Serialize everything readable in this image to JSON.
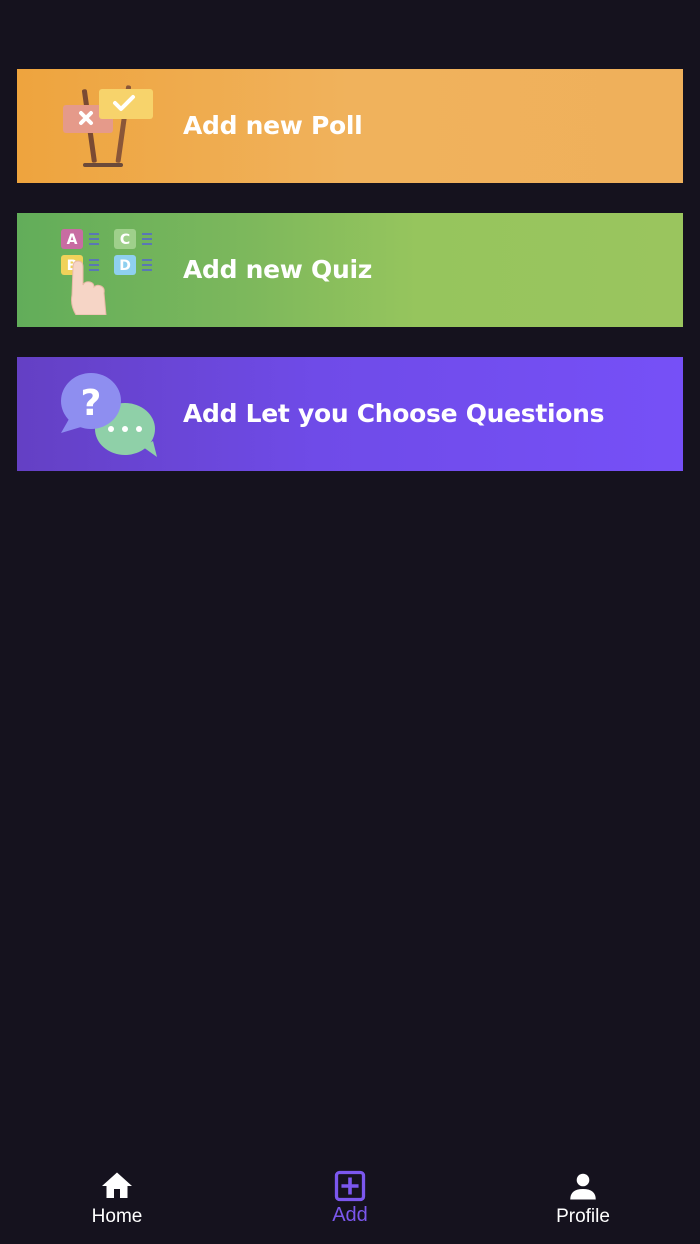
{
  "cards": [
    {
      "label": "Add new Poll",
      "icon": "poll-signs-icon",
      "gradient": [
        "#eea43e",
        "#efb05b"
      ]
    },
    {
      "label": "Add new Quiz",
      "icon": "quiz-abcd-icon",
      "gradient": [
        "#62ad5a",
        "#9ac55e"
      ]
    },
    {
      "label": "Add Let you Choose Questions",
      "icon": "chat-question-icon",
      "gradient": [
        "#6440c4",
        "#7650f7"
      ]
    }
  ],
  "nav": {
    "items": [
      {
        "label": "Home",
        "icon": "home-icon",
        "active": false
      },
      {
        "label": "Add",
        "icon": "add-box-icon",
        "active": true
      },
      {
        "label": "Profile",
        "icon": "profile-icon",
        "active": false
      }
    ],
    "active_color": "#7b57ee",
    "inactive_color": "#ffffff"
  },
  "colors": {
    "background": "#15121e"
  }
}
